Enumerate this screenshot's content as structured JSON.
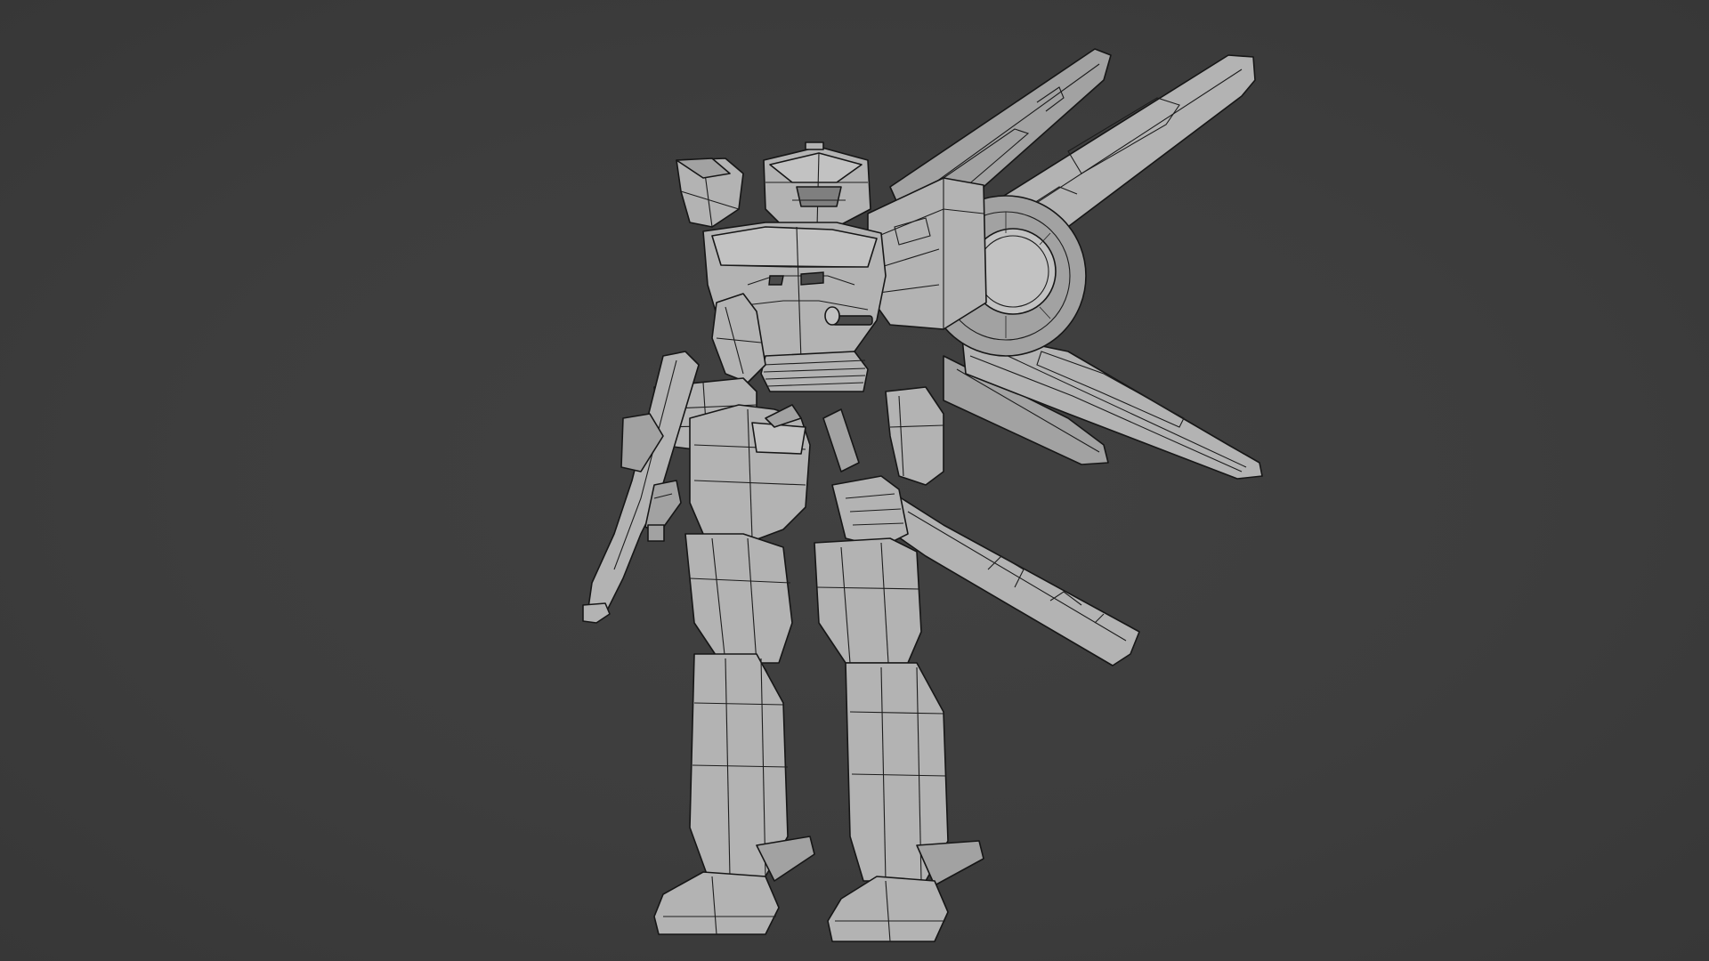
{
  "scene": {
    "background_color": "#3d3d3d",
    "mesh_color": "#b3b3b3",
    "wire_color": "#161616",
    "subject": "mech-robot-wireframe-model"
  }
}
